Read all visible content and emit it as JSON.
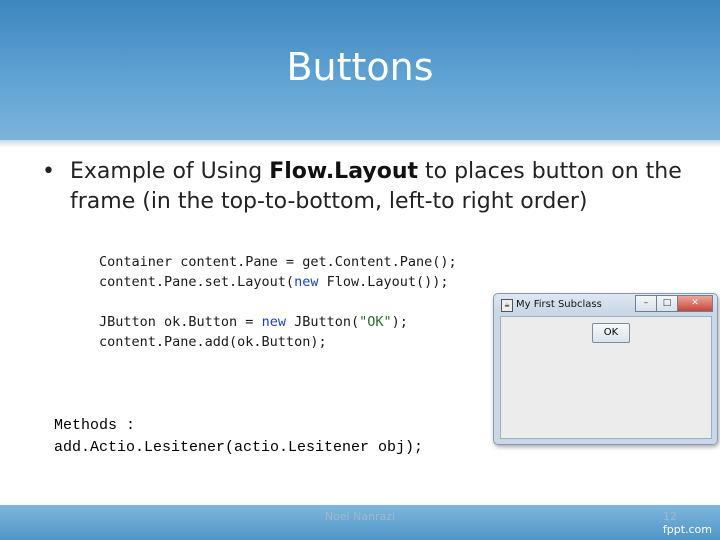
{
  "slide": {
    "title": "Buttons",
    "bullet_prefix": "Example of Using ",
    "bullet_bold": "Flow.Layout",
    "bullet_suffix": " to places button on the frame (in the top-to-bottom, left-to right order)",
    "code": {
      "line1_a": "Container content.Pane = get.Content.Pane();",
      "line2_a": "content.Pane.set.Layout(",
      "line2_kw": "new",
      "line2_b": " Flow.Layout());",
      "line3_a": "JButton ok.Button = ",
      "line3_kw": "new",
      "line3_b": " JButton(",
      "line3_str": "\"OK\"",
      "line3_c": ");",
      "line4_a": "content.Pane.add(ok.Button);"
    },
    "methods_label": "Methods :",
    "methods_signature": "add.Actio.Lesitener(actio.Lesitener obj);",
    "footer_author": "Noel Nanrazi",
    "page_number": "12",
    "brand": "fppt.com"
  },
  "java_window": {
    "title": "My First Subclass",
    "minimize_label": "–",
    "maximize_label": "□",
    "close_label": "✕",
    "button_label": "OK"
  }
}
